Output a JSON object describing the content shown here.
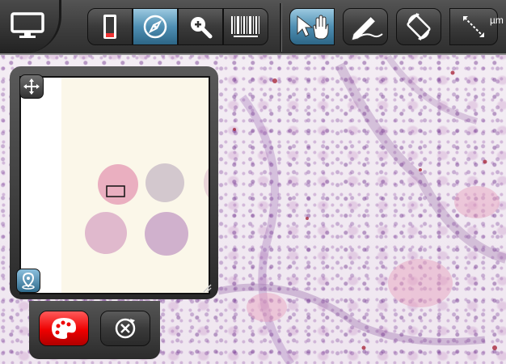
{
  "toolbar": {
    "home_icon": "monitor-icon",
    "view_tools": [
      {
        "name": "single-slide",
        "icon": "phone-view-icon",
        "active": false
      },
      {
        "name": "navigate",
        "icon": "compass-icon",
        "active": true
      },
      {
        "name": "zoom",
        "icon": "magnifier-plus-icon",
        "active": false
      },
      {
        "name": "barcode",
        "icon": "barcode-icon",
        "active": false
      }
    ],
    "action_tools": [
      {
        "name": "pointer-pan",
        "icon": "cursor-hand-icon",
        "active": true
      },
      {
        "name": "annotate",
        "icon": "pencil-icon",
        "active": false
      },
      {
        "name": "rotate",
        "icon": "rotate-icon",
        "active": false
      },
      {
        "name": "measure",
        "icon": "ruler-measure-icon",
        "active": false
      }
    ],
    "measure_unit": "µm"
  },
  "overview": {
    "move_icon": "move-arrows-icon",
    "location_icon": "map-pin-icon",
    "resize_icon": "resize-grip-icon"
  },
  "bottom_tools": [
    {
      "name": "color-palette",
      "icon": "palette-icon",
      "active": true
    },
    {
      "name": "close-annotation",
      "icon": "close-circle-icon",
      "active": false
    }
  ],
  "colors": {
    "active_blue": "#4f8fb3",
    "active_red": "#e00000",
    "stain_purple": "#7a3d8f",
    "stain_pink": "#e7a4c0"
  }
}
